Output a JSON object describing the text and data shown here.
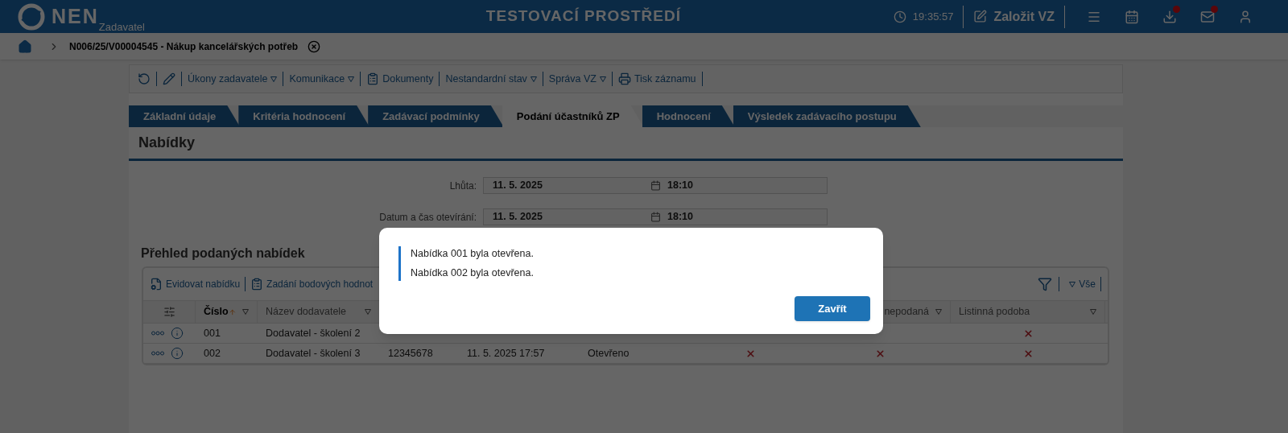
{
  "header": {
    "logo": "NEN",
    "logo_sub": "Zadavatel",
    "title": "TESTOVACÍ PROSTŘEDÍ",
    "time": "19:35:57",
    "create_button": "Založit VZ",
    "icons": [
      {
        "kind": "menu",
        "badge": false
      },
      {
        "kind": "calendar",
        "badge": false
      },
      {
        "kind": "download",
        "badge": true
      },
      {
        "kind": "mail",
        "badge": true
      },
      {
        "kind": "user",
        "badge": false
      }
    ]
  },
  "breadcrumb": {
    "item": "N006/25/V00004545 - Nákup kancelářských potřeb"
  },
  "toolbar": [
    {
      "kind": "refresh"
    },
    {
      "kind": "edit"
    },
    {
      "kind": "menu",
      "label": "Úkony zadavatele"
    },
    {
      "kind": "menu",
      "label": "Komunikace"
    },
    {
      "kind": "docs",
      "label": "Dokumenty"
    },
    {
      "kind": "menu",
      "label": "Nestandardní stav"
    },
    {
      "kind": "menu",
      "label": "Správa VZ"
    },
    {
      "kind": "print",
      "label": "Tisk záznamu"
    }
  ],
  "tabs": [
    {
      "label": "Základní údaje",
      "selected": false
    },
    {
      "label": "Kritéria hodnocení",
      "selected": false
    },
    {
      "label": "Zadávací podmínky",
      "selected": false
    },
    {
      "label": "Podání účastníků ZP",
      "selected": true
    },
    {
      "label": "Hodnocení",
      "selected": false
    },
    {
      "label": "Výsledek zadávacího postupu",
      "selected": false
    }
  ],
  "section_title": "Nabídky",
  "fields": [
    {
      "label": "Lhůta:",
      "date": "11. 5. 2025",
      "time": "18:10"
    },
    {
      "label": "Datum a čas otevírání:",
      "date": "11. 5. 2025",
      "time": "18:10"
    }
  ],
  "table_title": "Přehled podaných nabídek",
  "table_actions": [
    {
      "kind": "register",
      "label": "Evidovat nabídku"
    },
    {
      "kind": "docs",
      "label": "Zadání bodových hodnot"
    }
  ],
  "table_filter": "Vše",
  "columns": [
    {
      "kind": "settings"
    },
    {
      "label": "Číslo",
      "sort": true,
      "filter": true
    },
    {
      "label": "Název dodavatele",
      "filter": true
    },
    {},
    {},
    {},
    {},
    {
      "label": "nepodaná",
      "filter": true
    },
    {
      "label": "Listinná podoba",
      "filter": true
    }
  ],
  "rows": [
    {
      "cells": [
        null,
        "001",
        "Dodavatel - školení 2",
        null,
        null,
        null,
        null,
        null,
        {
          "kind": "cross"
        }
      ]
    },
    {
      "cells": [
        null,
        "002",
        "Dodavatel - školení 3",
        "12345678",
        "11. 5. 2025 17:57",
        "Otevřeno",
        {
          "kind": "cross"
        },
        {
          "kind": "cross"
        },
        {
          "kind": "cross"
        }
      ]
    }
  ],
  "dialog": {
    "messages": [
      "Nabídka 001 byla otevřena.",
      "Nabídka 002 byla otevřena."
    ],
    "button": "Zavřít"
  }
}
